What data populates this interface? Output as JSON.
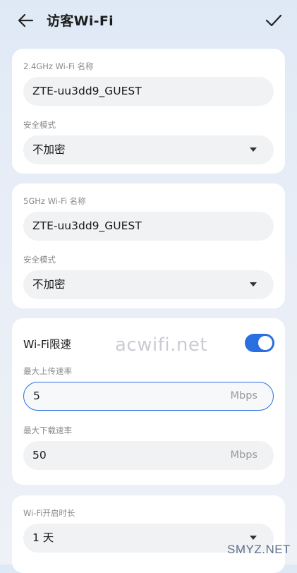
{
  "header": {
    "title": "访客Wi-Fi",
    "back_icon": "arrow-left-icon",
    "confirm_icon": "checkmark-icon"
  },
  "wifi24": {
    "name_label": "2.4GHz  Wi-Fi 名称",
    "name_value": "ZTE-uu3dd9_GUEST",
    "security_label": "安全模式",
    "security_value": "不加密"
  },
  "wifi5": {
    "name_label": "5GHz  Wi-Fi 名称",
    "name_value": "ZTE-uu3dd9_GUEST",
    "security_label": "安全模式",
    "security_value": "不加密"
  },
  "speed_limit": {
    "title": "Wi-Fi限速",
    "enabled": true,
    "upload_label": "最大上传速率",
    "upload_value": "5",
    "upload_unit": "Mbps",
    "download_label": "最大下载速率",
    "download_value": "50",
    "download_unit": "Mbps"
  },
  "duration": {
    "label": "Wi-Fi开启时长",
    "value": "1 天"
  },
  "watermarks": {
    "center": "acwifi.net",
    "corner": "SMYZ.NET"
  },
  "colors": {
    "accent": "#2a6fe0",
    "card": "#ffffff",
    "field": "#f1f2f4"
  }
}
